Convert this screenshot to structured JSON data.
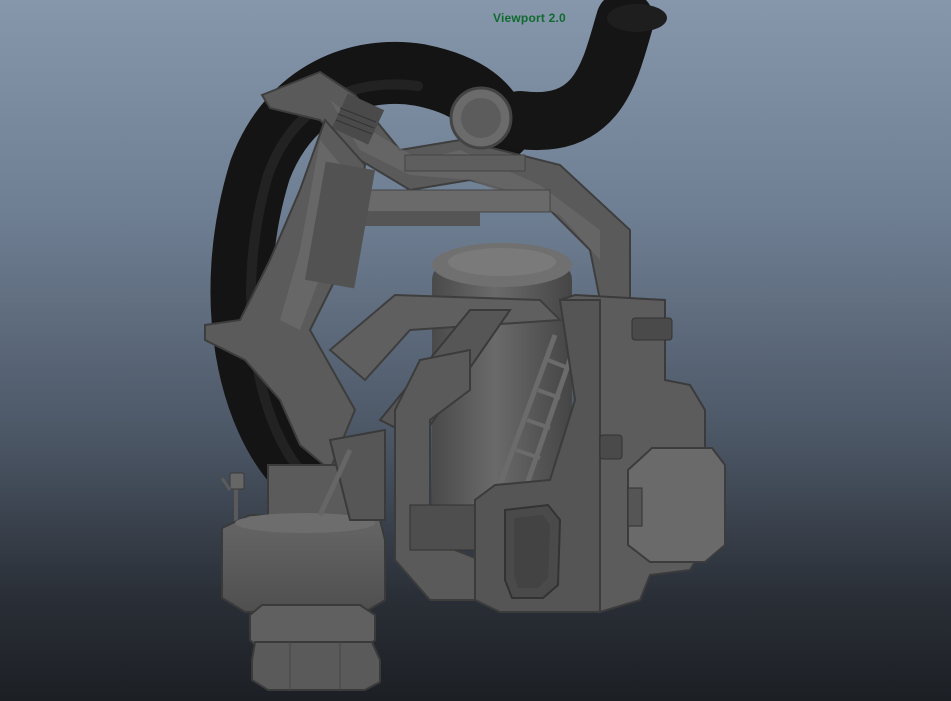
{
  "viewport": {
    "renderer_label": "Viewport 2.0"
  },
  "colors": {
    "background_top": "#8797ab",
    "background_bottom": "#1c1f24",
    "label_color": "#0f6a2e",
    "model_base": "#595959",
    "model_light": "#6e6e6e",
    "model_dark": "#3a3a3a",
    "hose_color": "#151515"
  },
  "model": {
    "name_icon": "mechanical-backpack-model"
  }
}
